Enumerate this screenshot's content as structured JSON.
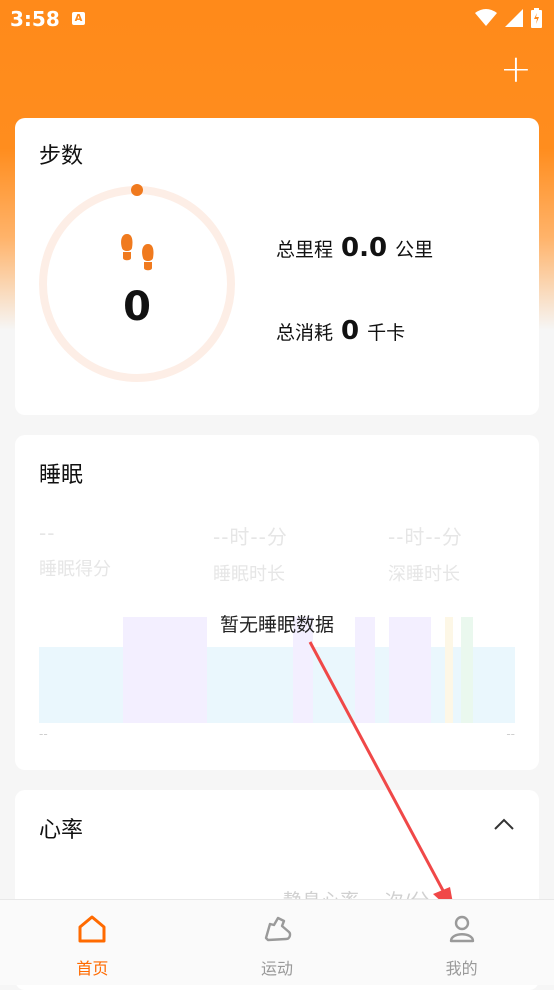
{
  "status_bar": {
    "time": "3:58",
    "notif_badge": "A"
  },
  "colors": {
    "accent": "#ff6a00",
    "ring_track": "#fdeee6",
    "hero": "#ff8a1a"
  },
  "steps": {
    "title": "步数",
    "value": "0",
    "distance_label": "总里程",
    "distance_value": "0.0",
    "distance_unit": "公里",
    "calories_label": "总消耗",
    "calories_value": "0",
    "calories_unit": "千卡"
  },
  "sleep": {
    "title": "睡眠",
    "stats": [
      {
        "value": "--",
        "label": "睡眠得分"
      },
      {
        "value": "--时--分",
        "label": "睡眠时长"
      },
      {
        "value": "--时--分",
        "label": "深睡时长"
      }
    ],
    "no_data": "暂无睡眠数据",
    "axis_left": "--",
    "axis_right": "--"
  },
  "heart": {
    "title": "心率",
    "resting_partial": "静息心率 -- 次/分"
  },
  "nav": {
    "items": [
      {
        "label": "首页",
        "icon": "home-icon",
        "active": true
      },
      {
        "label": "运动",
        "icon": "shoe-icon",
        "active": false
      },
      {
        "label": "我的",
        "icon": "person-icon",
        "active": false
      }
    ]
  }
}
